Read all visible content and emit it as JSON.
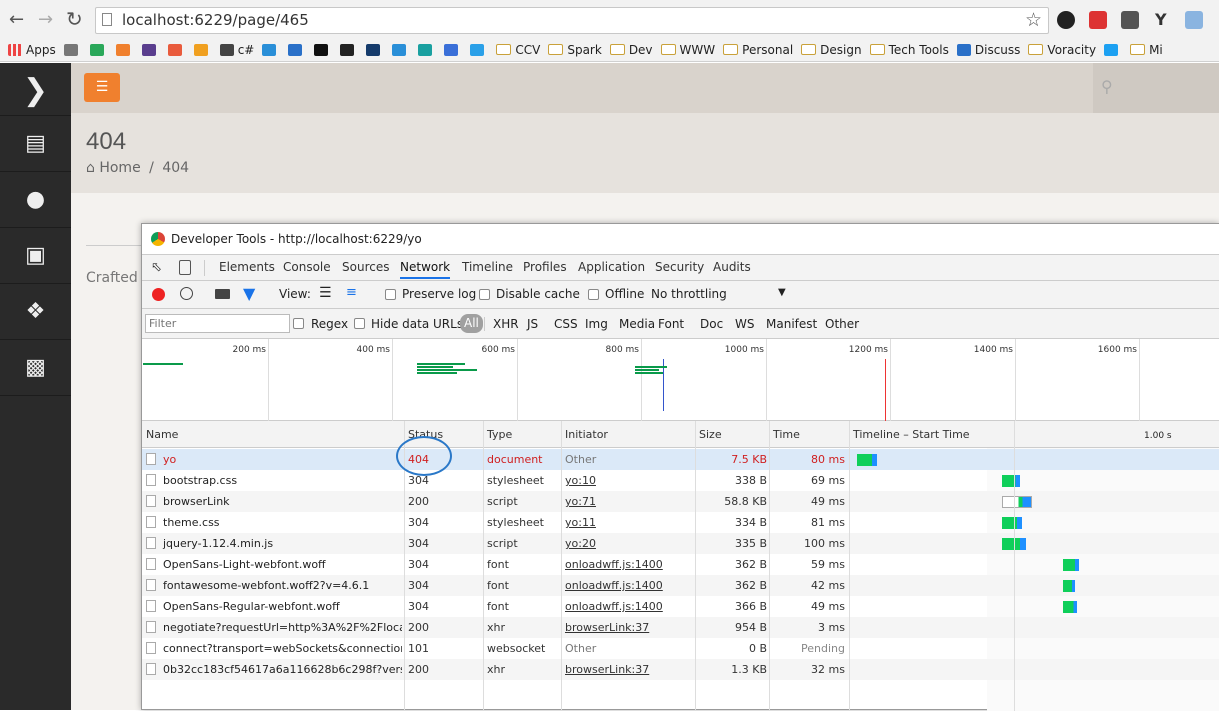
{
  "browser": {
    "url": "localhost:6229/page/465",
    "bookmarks": [
      {
        "label": "Apps",
        "kind": "apps"
      },
      {
        "label": "",
        "kind": "icon",
        "color": "#777"
      },
      {
        "label": "",
        "kind": "icon",
        "color": "#2aa85a"
      },
      {
        "label": "",
        "kind": "icon",
        "color": "#f0802e"
      },
      {
        "label": "",
        "kind": "icon",
        "color": "#5a3e8e"
      },
      {
        "label": "",
        "kind": "icon",
        "color": "#e95b3d"
      },
      {
        "label": "",
        "kind": "icon",
        "color": "#f0a020"
      },
      {
        "label": "c#",
        "kind": "icon",
        "color": "#444"
      },
      {
        "label": "",
        "kind": "icon",
        "color": "#2a8fd8"
      },
      {
        "label": "",
        "kind": "icon",
        "color": "#2a70c8"
      },
      {
        "label": "",
        "kind": "icon",
        "color": "#111"
      },
      {
        "label": "",
        "kind": "icon",
        "color": "#222"
      },
      {
        "label": "",
        "kind": "icon",
        "color": "#153b6b"
      },
      {
        "label": "",
        "kind": "icon",
        "color": "#2a8fd8"
      },
      {
        "label": "",
        "kind": "icon",
        "color": "#1aa0a0"
      },
      {
        "label": "",
        "kind": "icon",
        "color": "#3a6fd8"
      },
      {
        "label": "",
        "kind": "icon",
        "color": "#2aa0e8"
      },
      {
        "label": "CCV",
        "kind": "folder"
      },
      {
        "label": "Spark",
        "kind": "folder"
      },
      {
        "label": "Dev",
        "kind": "folder"
      },
      {
        "label": "WWW",
        "kind": "folder"
      },
      {
        "label": "Personal",
        "kind": "folder"
      },
      {
        "label": "Design",
        "kind": "folder"
      },
      {
        "label": "Tech Tools",
        "kind": "folder"
      },
      {
        "label": "Discuss",
        "kind": "icon",
        "color": "#2a70c8"
      },
      {
        "label": "Voracity",
        "kind": "folder"
      },
      {
        "label": "",
        "kind": "icon",
        "color": "#1da1f2"
      },
      {
        "label": "Mi",
        "kind": "folder"
      }
    ]
  },
  "site": {
    "page_title": "404",
    "crumb_home": "Home",
    "crumb_sep": "/",
    "crumb_current": "404",
    "footer_text": "Crafted b"
  },
  "devtools": {
    "title": "Developer Tools - http://localhost:6229/yo",
    "tabs": [
      "Elements",
      "Console",
      "Sources",
      "Network",
      "Timeline",
      "Profiles",
      "Application",
      "Security",
      "Audits"
    ],
    "active_tab": "Network",
    "view_label": "View:",
    "preserve_log": "Preserve log",
    "disable_cache": "Disable cache",
    "offline": "Offline",
    "throttling": "No throttling",
    "filter_placeholder": "Filter",
    "regex": "Regex",
    "hide_data_urls": "Hide data URLs",
    "filter_types": [
      "All",
      "XHR",
      "JS",
      "CSS",
      "Img",
      "Media",
      "Font",
      "Doc",
      "WS",
      "Manifest",
      "Other"
    ],
    "overview_ticks": [
      "200 ms",
      "400 ms",
      "600 ms",
      "800 ms",
      "1000 ms",
      "1200 ms",
      "1400 ms",
      "1600 ms"
    ],
    "columns": {
      "name": "Name",
      "status": "Status",
      "type": "Type",
      "initiator": "Initiator",
      "size": "Size",
      "time": "Time",
      "timeline": "Timeline – Start Time",
      "timeline_tick": "1.00 s"
    },
    "rows": [
      {
        "name": "yo",
        "status": "404",
        "type": "document",
        "initiator": "Other",
        "size": "7.5 KB",
        "time": "80 ms",
        "error": true,
        "link": false,
        "wf_start_ms": 25,
        "wf_dur_ms": 50
      },
      {
        "name": "bootstrap.css",
        "status": "304",
        "type": "stylesheet",
        "initiator": "yo:10",
        "size": "338 B",
        "time": "69 ms",
        "error": false,
        "link": true,
        "wf_start_ms": 930,
        "wf_dur_ms": 45
      },
      {
        "name": "browserLink",
        "status": "200",
        "type": "script",
        "initiator": "yo:71",
        "size": "58.8 KB",
        "time": "49 ms",
        "error": false,
        "link": true,
        "wf_start_ms": 930,
        "wf_dur_ms": 75
      },
      {
        "name": "theme.css",
        "status": "304",
        "type": "stylesheet",
        "initiator": "yo:11",
        "size": "334 B",
        "time": "81 ms",
        "error": false,
        "link": true,
        "wf_start_ms": 930,
        "wf_dur_ms": 50
      },
      {
        "name": "jquery-1.12.4.min.js",
        "status": "304",
        "type": "script",
        "initiator": "yo:20",
        "size": "335 B",
        "time": "100 ms",
        "error": false,
        "link": true,
        "wf_start_ms": 930,
        "wf_dur_ms": 60
      },
      {
        "name": "OpenSans-Light-webfont.woff",
        "status": "304",
        "type": "font",
        "initiator": "onloadwff.js:1400",
        "size": "362 B",
        "time": "59 ms",
        "error": false,
        "link": true,
        "wf_start_ms": 1310,
        "wf_dur_ms": 40
      },
      {
        "name": "fontawesome-webfont.woff2?v=4.6.1",
        "status": "304",
        "type": "font",
        "initiator": "onloadwff.js:1400",
        "size": "362 B",
        "time": "42 ms",
        "error": false,
        "link": true,
        "wf_start_ms": 1310,
        "wf_dur_ms": 30
      },
      {
        "name": "OpenSans-Regular-webfont.woff",
        "status": "304",
        "type": "font",
        "initiator": "onloadwff.js:1400",
        "size": "366 B",
        "time": "49 ms",
        "error": false,
        "link": true,
        "wf_start_ms": 1310,
        "wf_dur_ms": 35
      },
      {
        "name": "negotiate?requestUrl=http%3A%2F%2Flocalh...",
        "status": "200",
        "type": "xhr",
        "initiator": "browserLink:37",
        "size": "954 B",
        "time": "3 ms",
        "error": false,
        "link": true,
        "wf_start_ms": null,
        "wf_dur_ms": null
      },
      {
        "name": "connect?transport=webSockets&connectionT...",
        "status": "101",
        "type": "websocket",
        "initiator": "Other",
        "size": "0 B",
        "time": "Pending",
        "error": false,
        "link": false,
        "wf_start_ms": null,
        "wf_dur_ms": null
      },
      {
        "name": "0b32cc183cf54617a6a116628b6c298f?version...",
        "status": "200",
        "type": "xhr",
        "initiator": "browserLink:37",
        "size": "1.3 KB",
        "time": "32 ms",
        "error": false,
        "link": true,
        "wf_start_ms": null,
        "wf_dur_ms": null
      }
    ]
  },
  "colors": {
    "error": "#d01f1f",
    "waterfall_green": "#0fcf5a",
    "waterfall_blue": "#1e90ff",
    "accent": "#f0802e",
    "annotation": "#2a78c8"
  }
}
